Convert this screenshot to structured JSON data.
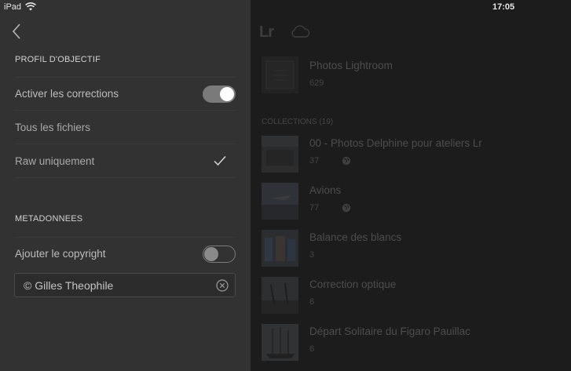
{
  "status_bar": {
    "device": "iPad",
    "time": "17:05"
  },
  "settings": {
    "lens_profile": {
      "header": "PROFIL D'OBJECTIF",
      "enable_corrections_label": "Activer les corrections",
      "enable_corrections_on": true,
      "option_all_files": "Tous les fichiers",
      "option_raw_only": "Raw uniquement",
      "selected_option": "Raw uniquement"
    },
    "metadata": {
      "header": "METADONNEES",
      "add_copyright_label": "Ajouter le copyright",
      "add_copyright_on": false,
      "copyright_value": "© Gilles Theophile"
    }
  },
  "library": {
    "logo": "Lr",
    "all_photos": {
      "title": "Photos Lightroom",
      "count": "629"
    },
    "collections_header": "COLLECTIONS (19)",
    "collections": [
      {
        "title": "00 - Photos Delphine pour ateliers Lr",
        "count": "37",
        "shared": true
      },
      {
        "title": "Avions",
        "count": "77",
        "shared": true
      },
      {
        "title": "Balance des blancs",
        "count": "3",
        "shared": false
      },
      {
        "title": "Correction optique",
        "count": "6",
        "shared": false
      },
      {
        "title": "Départ Solitaire du Figaro Pauillac",
        "count": "6",
        "shared": false
      }
    ]
  },
  "icons": {
    "back": "chevron-left-icon",
    "wifi": "wifi-icon",
    "check": "checkmark-icon",
    "clear": "clear-circle-icon",
    "cloud": "cloud-icon",
    "globe": "globe-icon"
  },
  "colors": {
    "panel_bg": "#323232",
    "toggle_on_track": "#7a7a7a",
    "toggle_knob_on": "#ffffff"
  }
}
